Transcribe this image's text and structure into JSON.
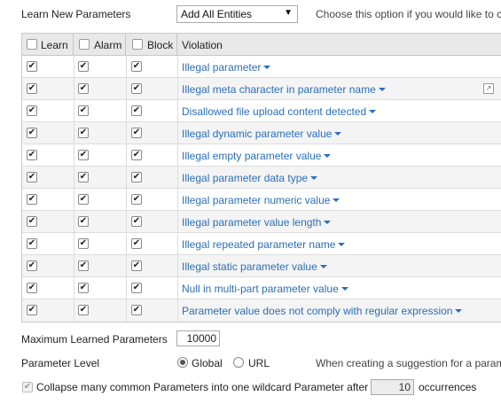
{
  "learn_new": {
    "label": "Learn New Parameters",
    "select_value": "Add All Entities",
    "hint": "Choose this option if you would like to c"
  },
  "grid": {
    "headers": {
      "learn": "Learn",
      "alarm": "Alarm",
      "block": "Block",
      "violation": "Violation"
    },
    "rows": [
      {
        "violation": "Illegal parameter",
        "learn": true,
        "alarm": true,
        "block": true
      },
      {
        "violation": "Illegal meta character in parameter name",
        "learn": true,
        "alarm": true,
        "block": true
      },
      {
        "violation": "Disallowed file upload content detected",
        "learn": true,
        "alarm": true,
        "block": true
      },
      {
        "violation": "Illegal dynamic parameter value",
        "learn": true,
        "alarm": true,
        "block": true
      },
      {
        "violation": "Illegal empty parameter value",
        "learn": true,
        "alarm": true,
        "block": true
      },
      {
        "violation": "Illegal parameter data type",
        "learn": true,
        "alarm": true,
        "block": true
      },
      {
        "violation": "Illegal parameter numeric value",
        "learn": true,
        "alarm": true,
        "block": true
      },
      {
        "violation": "Illegal parameter value length",
        "learn": true,
        "alarm": true,
        "block": true
      },
      {
        "violation": "Illegal repeated parameter name",
        "learn": true,
        "alarm": true,
        "block": true
      },
      {
        "violation": "Illegal static parameter value",
        "learn": true,
        "alarm": true,
        "block": true
      },
      {
        "violation": "Null in multi-part parameter value",
        "learn": true,
        "alarm": true,
        "block": true
      },
      {
        "violation": "Parameter value does not comply with regular expression",
        "learn": true,
        "alarm": true,
        "block": true
      }
    ]
  },
  "max_learned": {
    "label": "Maximum Learned Parameters",
    "value": "10000"
  },
  "param_level": {
    "label": "Parameter Level",
    "options": [
      {
        "label": "Global",
        "selected": true
      },
      {
        "label": "URL",
        "selected": false
      }
    ],
    "hint": "When creating a suggestion for a param"
  },
  "collapse": {
    "checked": true,
    "label_before": "Collapse many common Parameters into one wildcard Parameter after",
    "value": "10",
    "label_after": "occurrences"
  },
  "colors": {
    "link": "#2a6ebb",
    "header_bg": "#e8e8e8",
    "alt_row": "#f4f4f4"
  }
}
